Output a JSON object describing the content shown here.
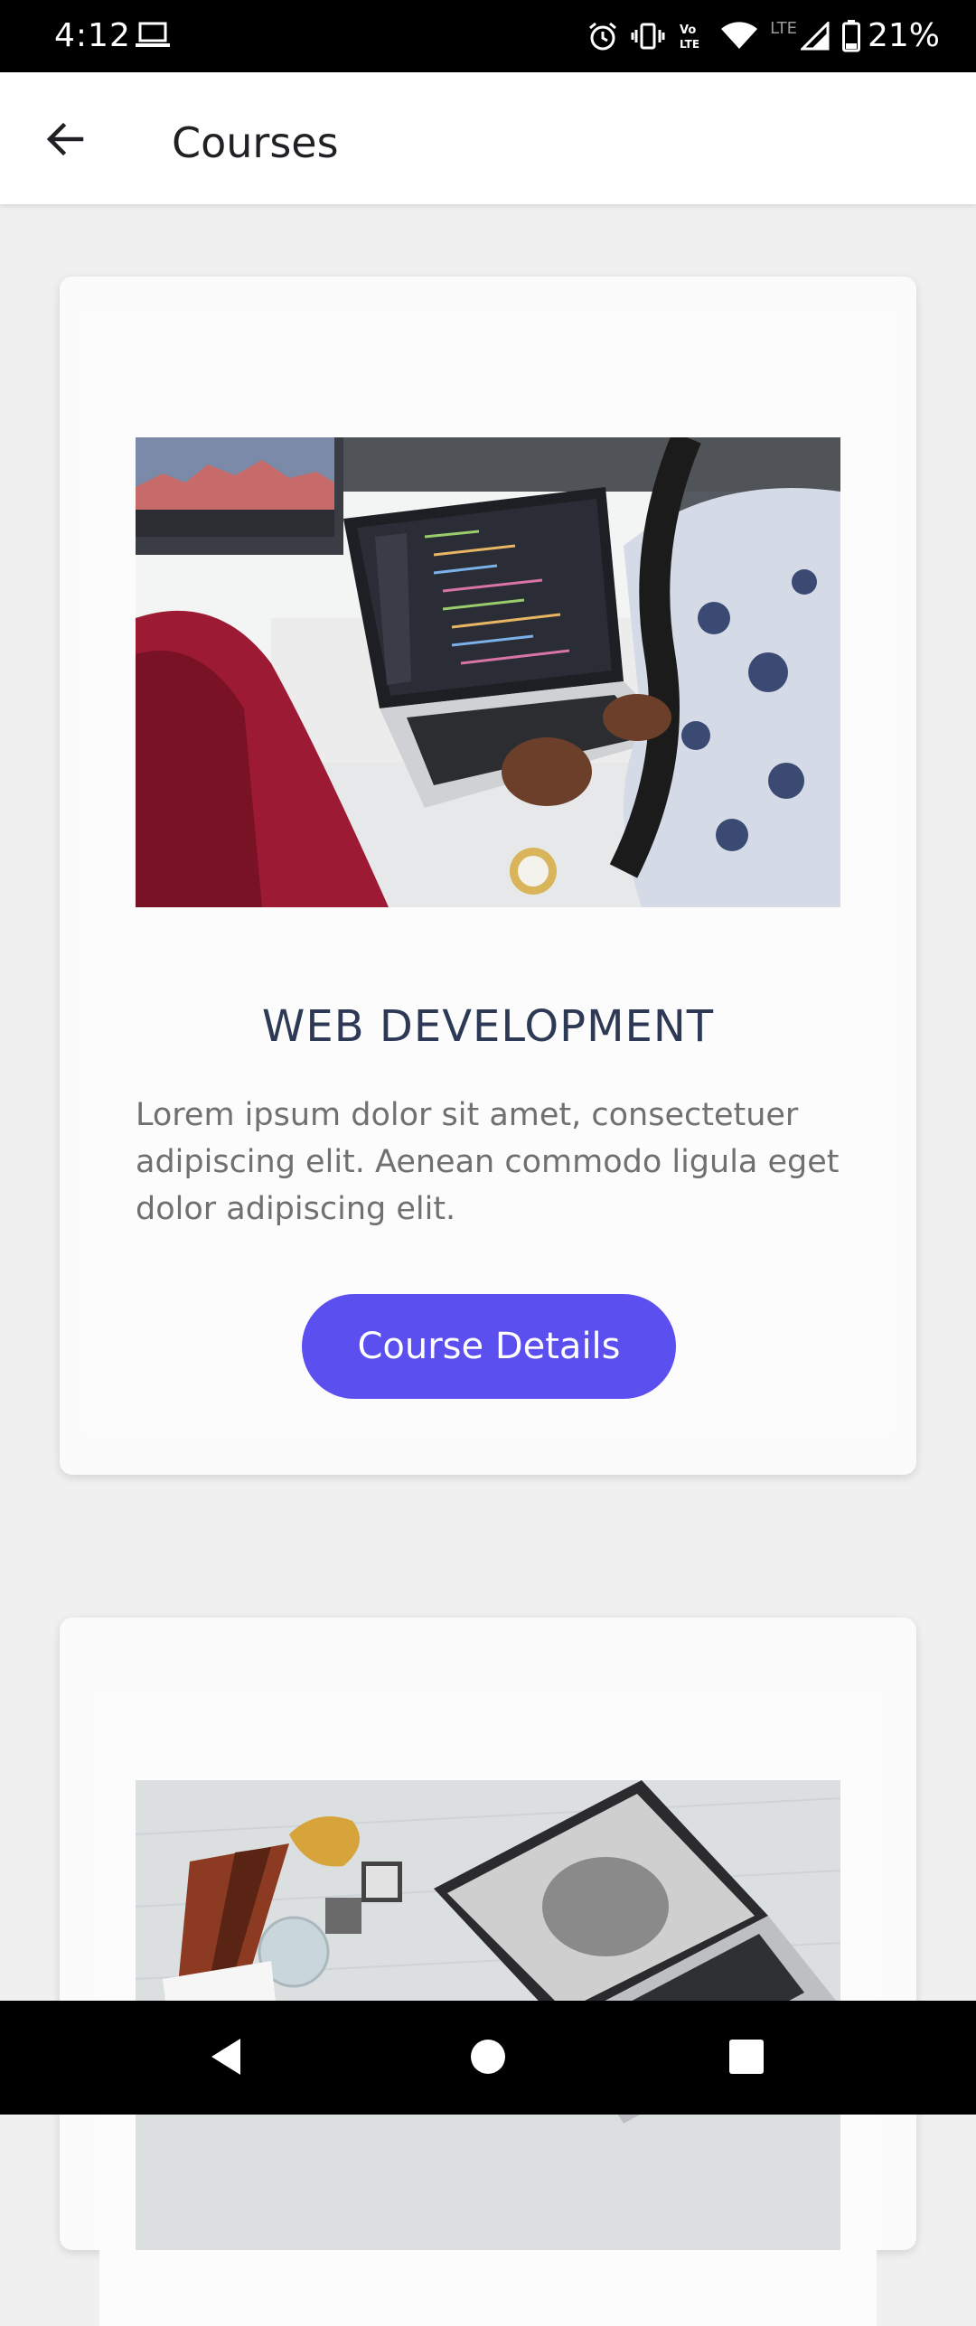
{
  "status_bar": {
    "time": "4:12",
    "battery": "21%",
    "network_small": "LTE",
    "icons": [
      "laptop-icon",
      "alarm-icon",
      "vibrate-icon",
      "volte-icon",
      "wifi-icon",
      "signal-icon",
      "battery-icon"
    ]
  },
  "app_bar": {
    "title": "Courses",
    "back_icon": "arrow-back-icon"
  },
  "courses": [
    {
      "title": "WEB DEVELOPMENT",
      "description": "Lorem ipsum dolor sit amet, consectetuer adipiscing elit. Aenean commodo ligula eget dolor adipiscing elit.",
      "button_label": "Course Details",
      "image": "laptop-coding-photo"
    },
    {
      "image": "laptop-sketch-desk-photo"
    }
  ],
  "nav_bar": {
    "icons": [
      "nav-back-icon",
      "nav-home-icon",
      "nav-recents-icon"
    ]
  },
  "colors": {
    "accent": "#5b4ff0",
    "title_text": "#2e3a55",
    "body_text": "#707070",
    "background": "#f0f0f0"
  }
}
